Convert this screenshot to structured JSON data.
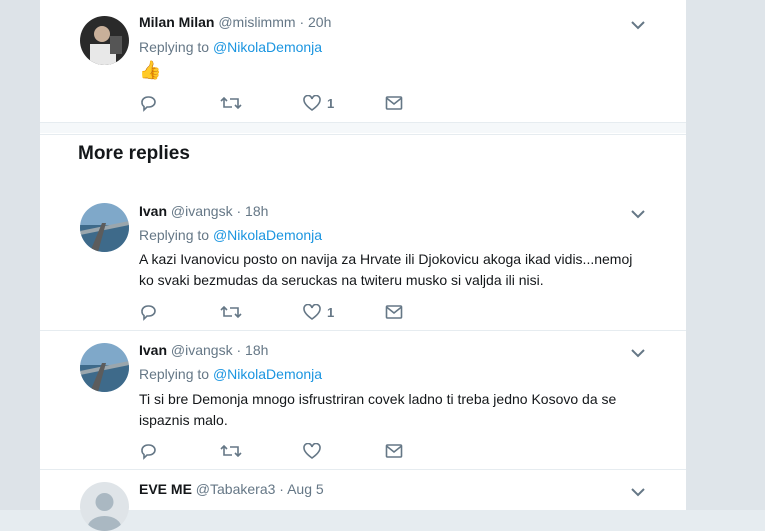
{
  "replies": [
    {
      "name": "Milan Milan",
      "handle": "@mislimmm",
      "separator": "·",
      "time": "20h",
      "replying_prefix": "Replying to",
      "replying_to": "@NikolaDemonja",
      "text": "👍",
      "likes": "1"
    }
  ],
  "more_replies": {
    "heading": "More replies",
    "tweets": [
      {
        "name": "Ivan",
        "handle": "@ivangsk",
        "separator": "·",
        "time": "18h",
        "replying_prefix": "Replying to",
        "replying_to": "@NikolaDemonja",
        "text": "A kazi Ivanovicu posto on navija za Hrvate ili Djokovicu akoga ikad vidis...nemoj ko svaki bezmudas da seruckas na twiteru musko si valjda ili nisi.",
        "likes": "1"
      },
      {
        "name": "Ivan",
        "handle": "@ivangsk",
        "separator": "·",
        "time": "18h",
        "replying_prefix": "Replying to",
        "replying_to": "@NikolaDemonja",
        "text": "Ti si bre Demonja mnogo isfrustriran covek ladno ti treba jedno Kosovo da se ispaznis malo.",
        "likes": ""
      },
      {
        "name": "EVE ME",
        "handle": "@Tabakera3",
        "separator": "·",
        "time": "Aug 5"
      }
    ]
  },
  "colors": {
    "link": "#1b95e0",
    "muted": "#657786",
    "text": "#14171a",
    "background": "#e6ecf0"
  },
  "icons": [
    "chevron-down-icon",
    "reply-icon",
    "retweet-icon",
    "heart-icon",
    "direct-message-icon"
  ]
}
